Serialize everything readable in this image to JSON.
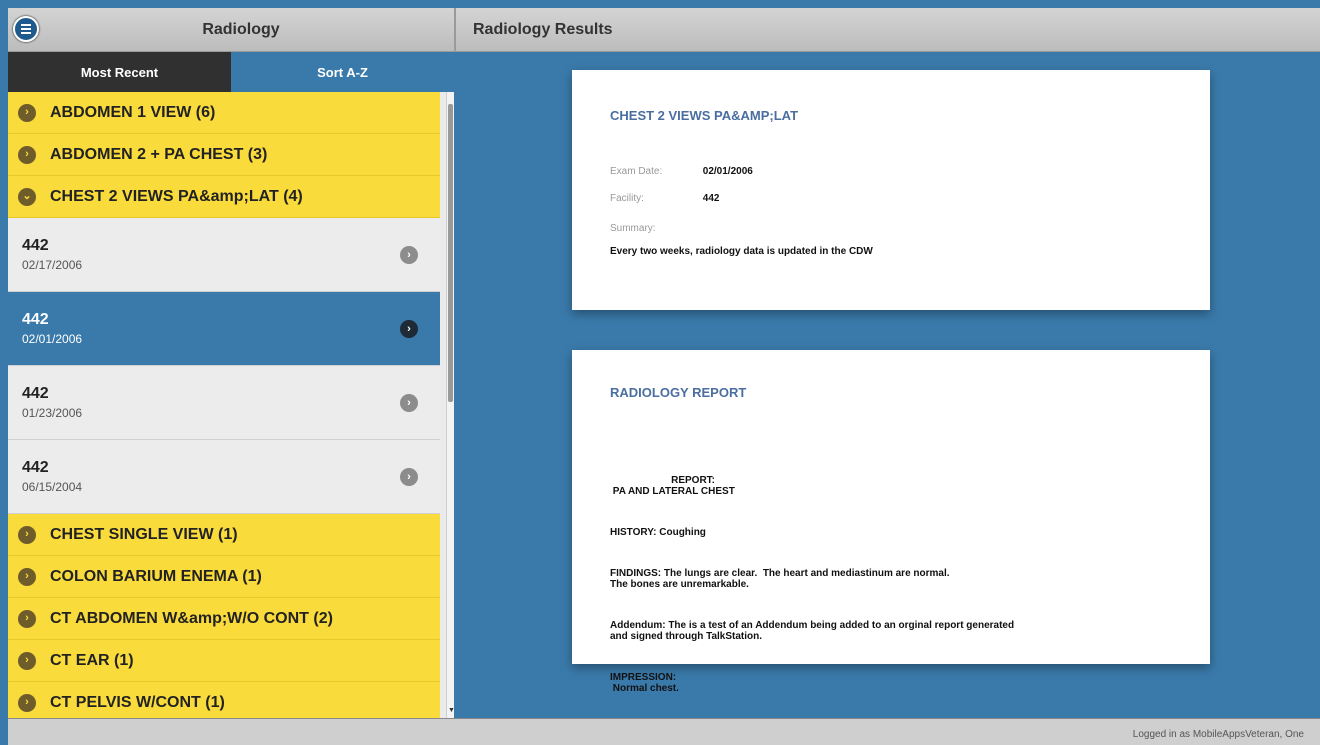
{
  "left_panel": {
    "title": "Radiology",
    "segments": {
      "recent": "Most Recent",
      "az": "Sort A-Z"
    },
    "categories_top": [
      {
        "label": "ABDOMEN 1 VIEW (6)",
        "icon": "chevron-right-icon"
      },
      {
        "label": "ABDOMEN 2 + PA CHEST (3)",
        "icon": "chevron-right-icon"
      },
      {
        "label": "CHEST 2 VIEWS PA&amp;LAT (4)",
        "icon": "chevron-down-icon"
      }
    ],
    "entries": [
      {
        "facility": "442",
        "date": "02/17/2006"
      },
      {
        "facility": "442",
        "date": "02/01/2006"
      },
      {
        "facility": "442",
        "date": "01/23/2006"
      },
      {
        "facility": "442",
        "date": "06/15/2004"
      }
    ],
    "categories_bottom": [
      {
        "label": "CHEST SINGLE VIEW (1)"
      },
      {
        "label": "COLON BARIUM ENEMA (1)"
      },
      {
        "label": "CT ABDOMEN W&amp;W/O CONT (2)"
      },
      {
        "label": "CT EAR (1)"
      },
      {
        "label": "CT PELVIS W/CONT (1)"
      }
    ]
  },
  "right_panel": {
    "title": "Radiology Results",
    "card1": {
      "heading": "CHEST 2 VIEWS PA&AMP;LAT",
      "exam_date_label": "Exam Date:",
      "exam_date": "02/01/2006",
      "facility_label": "Facility:",
      "facility": "442",
      "summary_label": "Summary:",
      "summary": "Every two weeks, radiology data is updated in the CDW"
    },
    "card2": {
      "heading": "RADIOLOGY REPORT",
      "report_line1": "                      REPORT:",
      "report_line2": " PA AND LATERAL CHEST",
      "history": "HISTORY: Coughing",
      "findings_1": "FINDINGS: The lungs are clear.  The heart and mediastinum are normal.",
      "findings_2": "The bones are unremarkable.",
      "addendum_1": "Addendum: The is a test of an Addendum being added to an orginal report generated",
      "addendum_2": "and signed through TalkStation.",
      "impression_1": "IMPRESSION:",
      "impression_2": " Normal chest."
    }
  },
  "footer": {
    "status": "Logged in as MobileAppsVeteran, One"
  },
  "colors": {
    "accent": "#3a7aab",
    "category": "#fadb3c",
    "heading": "#4a6ea0"
  }
}
